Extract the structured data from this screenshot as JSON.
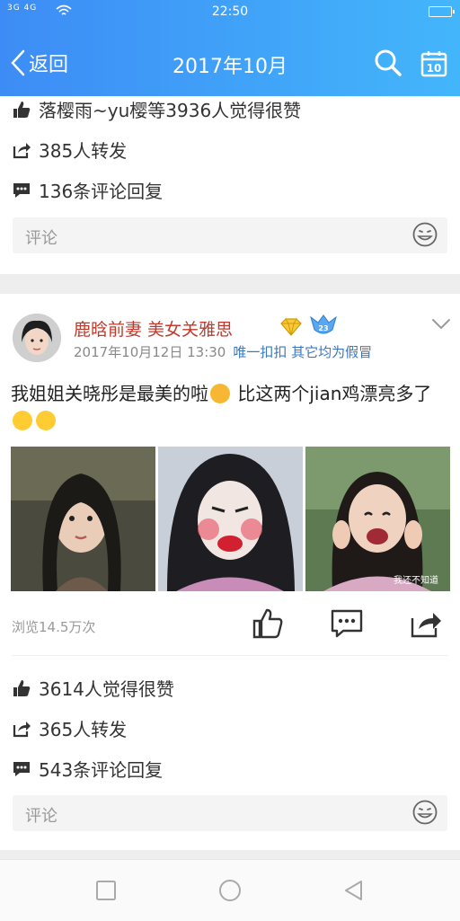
{
  "status_bar": {
    "signal": "3G 4G",
    "time": "22:50"
  },
  "nav": {
    "back_label": "返回",
    "title": "2017年10月"
  },
  "prev_post": {
    "likes": "落樱雨~yu樱等3936人觉得很赞",
    "reposts": "385人转发",
    "comments": "136条评论回复",
    "comment_placeholder": "评论"
  },
  "post": {
    "username": "鹿晗前妻  美女关雅思",
    "timestamp": "2017年10月12日  13:30",
    "source": "唯一扣扣 其它均为假冒",
    "vip_badge": "23",
    "text_part1": "我姐姐关晓彤是最美的啦",
    "text_part2": "  比这两个jian鸡漂亮多了",
    "photo_caption": "我还不知道",
    "views": "浏览14.5万次",
    "likes": "3614人觉得很赞",
    "reposts": "365人转发",
    "comments": "543条评论回复",
    "comment_placeholder": "评论"
  },
  "icons": {
    "like": "thumbs-up-icon",
    "share": "share-icon",
    "comment": "comment-icon",
    "search": "search-icon",
    "calendar": "calendar-icon"
  },
  "colors": {
    "header_start": "#3d8cf5",
    "header_end": "#43b6fb",
    "username": "#c0392b",
    "source": "#3a78c6"
  }
}
